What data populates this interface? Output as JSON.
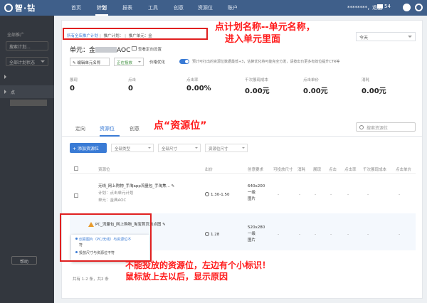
{
  "topbar": {
    "logo": "智·钻",
    "nav": [
      "首页",
      "计划",
      "报表",
      "工具",
      "创意",
      "资源位",
      "账户"
    ],
    "active_nav": "计划",
    "user": "********，退出",
    "mail_count": "54"
  },
  "sidebar": {
    "title": "全部推广",
    "search_placeholder": "搜索计划...",
    "filter": "全部计划状态",
    "item1": "",
    "item2": "点",
    "feedback": "帮助"
  },
  "breadcrumb": {
    "items": [
      "所有全店推广计划",
      "推广计划：",
      "推广单元：金"
    ]
  },
  "annotations": {
    "a1_line1": "点计划名称--单元名称，",
    "a1_line2": "进入单元里面",
    "a2": "点“资源位”",
    "a3_line1": "不能投放的资源位，左边有个小标识！",
    "a3_line2": "鼠标放上去以后，显示原因"
  },
  "unit": {
    "title": "单元：金",
    "title_suffix": "AOC",
    "settings_link": "查看定向设置",
    "edit_button": "编辑单元名称",
    "status": "正在投放",
    "optimize_label": "价格优化",
    "hint": "预计可打出的资源位数据最低+3，估算优化将可能完全分发，请按出价更多有效位提升CTR等"
  },
  "date_select": "今天",
  "metrics": [
    {
      "label": "展现",
      "value": "0"
    },
    {
      "label": "点击",
      "value": "0"
    },
    {
      "label": "点击率",
      "value": "0.00%"
    },
    {
      "label": "千次展现成本",
      "value": "0.00元"
    },
    {
      "label": "点击单价",
      "value": "0.00元"
    },
    {
      "label": "消耗",
      "value": "0.00元"
    }
  ],
  "tabs": [
    "定向",
    "资源位",
    "创意"
  ],
  "active_tab": "资源位",
  "search_placeholder": "搜索资源位",
  "toolbar": {
    "add_button": "添加资源位",
    "filter1": "全部类型",
    "filter2": "全部尺寸",
    "filter3": "资源位尺寸"
  },
  "table": {
    "headers": [
      "资源位",
      "出价",
      "创意要求",
      "可投放尺寸",
      "消耗",
      "展现",
      "点击",
      "点击率",
      "千次展现成本",
      "点击单价"
    ],
    "rows": [
      {
        "name": "无线_网上购物_手淘app流量包_手淘焦...",
        "sub1": "计划：点击单元计划",
        "sub2": "单元：金典AOC",
        "bid": "1.30-1.50",
        "req": [
          "640x200",
          "一级",
          "图片"
        ]
      },
      {
        "name": "PC_流量包_网上购物_淘宝首页焦点图",
        "bid": "1.28",
        "req": [
          "520x280",
          "一级",
          "图片"
        ]
      }
    ],
    "dash": "-"
  },
  "tooltip": {
    "line1": "创意图片（PC/无线）与资源位不",
    "line1b": "符",
    "line2": "投放尺寸与资源位不符"
  },
  "pager": "共有 1-2 条，共2 条"
}
